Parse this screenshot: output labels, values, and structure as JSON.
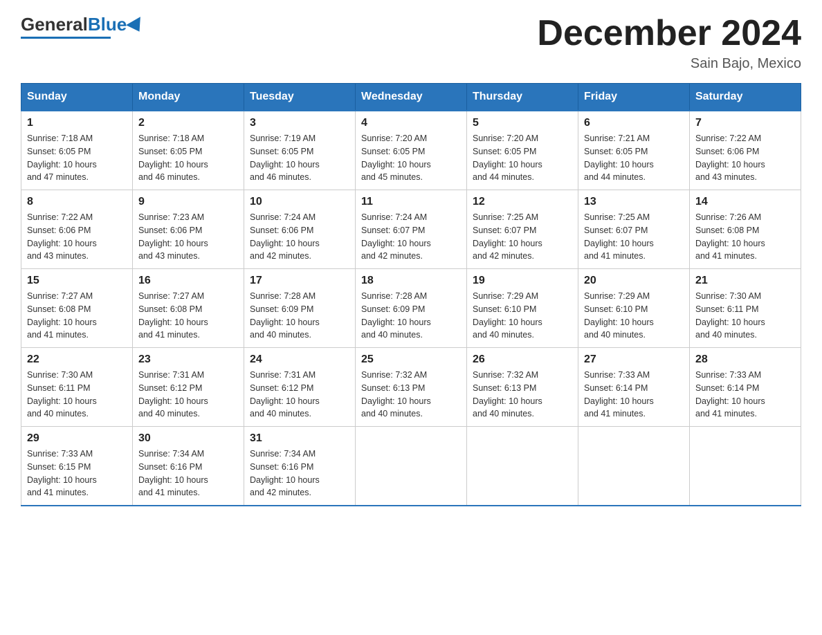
{
  "header": {
    "logo": {
      "general": "General",
      "blue": "Blue"
    },
    "title": "December 2024",
    "location": "Sain Bajo, Mexico"
  },
  "days_of_week": [
    "Sunday",
    "Monday",
    "Tuesday",
    "Wednesday",
    "Thursday",
    "Friday",
    "Saturday"
  ],
  "weeks": [
    [
      {
        "day": "1",
        "sunrise": "7:18 AM",
        "sunset": "6:05 PM",
        "daylight": "10 hours and 47 minutes."
      },
      {
        "day": "2",
        "sunrise": "7:18 AM",
        "sunset": "6:05 PM",
        "daylight": "10 hours and 46 minutes."
      },
      {
        "day": "3",
        "sunrise": "7:19 AM",
        "sunset": "6:05 PM",
        "daylight": "10 hours and 46 minutes."
      },
      {
        "day": "4",
        "sunrise": "7:20 AM",
        "sunset": "6:05 PM",
        "daylight": "10 hours and 45 minutes."
      },
      {
        "day": "5",
        "sunrise": "7:20 AM",
        "sunset": "6:05 PM",
        "daylight": "10 hours and 44 minutes."
      },
      {
        "day": "6",
        "sunrise": "7:21 AM",
        "sunset": "6:05 PM",
        "daylight": "10 hours and 44 minutes."
      },
      {
        "day": "7",
        "sunrise": "7:22 AM",
        "sunset": "6:06 PM",
        "daylight": "10 hours and 43 minutes."
      }
    ],
    [
      {
        "day": "8",
        "sunrise": "7:22 AM",
        "sunset": "6:06 PM",
        "daylight": "10 hours and 43 minutes."
      },
      {
        "day": "9",
        "sunrise": "7:23 AM",
        "sunset": "6:06 PM",
        "daylight": "10 hours and 43 minutes."
      },
      {
        "day": "10",
        "sunrise": "7:24 AM",
        "sunset": "6:06 PM",
        "daylight": "10 hours and 42 minutes."
      },
      {
        "day": "11",
        "sunrise": "7:24 AM",
        "sunset": "6:07 PM",
        "daylight": "10 hours and 42 minutes."
      },
      {
        "day": "12",
        "sunrise": "7:25 AM",
        "sunset": "6:07 PM",
        "daylight": "10 hours and 42 minutes."
      },
      {
        "day": "13",
        "sunrise": "7:25 AM",
        "sunset": "6:07 PM",
        "daylight": "10 hours and 41 minutes."
      },
      {
        "day": "14",
        "sunrise": "7:26 AM",
        "sunset": "6:08 PM",
        "daylight": "10 hours and 41 minutes."
      }
    ],
    [
      {
        "day": "15",
        "sunrise": "7:27 AM",
        "sunset": "6:08 PM",
        "daylight": "10 hours and 41 minutes."
      },
      {
        "day": "16",
        "sunrise": "7:27 AM",
        "sunset": "6:08 PM",
        "daylight": "10 hours and 41 minutes."
      },
      {
        "day": "17",
        "sunrise": "7:28 AM",
        "sunset": "6:09 PM",
        "daylight": "10 hours and 40 minutes."
      },
      {
        "day": "18",
        "sunrise": "7:28 AM",
        "sunset": "6:09 PM",
        "daylight": "10 hours and 40 minutes."
      },
      {
        "day": "19",
        "sunrise": "7:29 AM",
        "sunset": "6:10 PM",
        "daylight": "10 hours and 40 minutes."
      },
      {
        "day": "20",
        "sunrise": "7:29 AM",
        "sunset": "6:10 PM",
        "daylight": "10 hours and 40 minutes."
      },
      {
        "day": "21",
        "sunrise": "7:30 AM",
        "sunset": "6:11 PM",
        "daylight": "10 hours and 40 minutes."
      }
    ],
    [
      {
        "day": "22",
        "sunrise": "7:30 AM",
        "sunset": "6:11 PM",
        "daylight": "10 hours and 40 minutes."
      },
      {
        "day": "23",
        "sunrise": "7:31 AM",
        "sunset": "6:12 PM",
        "daylight": "10 hours and 40 minutes."
      },
      {
        "day": "24",
        "sunrise": "7:31 AM",
        "sunset": "6:12 PM",
        "daylight": "10 hours and 40 minutes."
      },
      {
        "day": "25",
        "sunrise": "7:32 AM",
        "sunset": "6:13 PM",
        "daylight": "10 hours and 40 minutes."
      },
      {
        "day": "26",
        "sunrise": "7:32 AM",
        "sunset": "6:13 PM",
        "daylight": "10 hours and 40 minutes."
      },
      {
        "day": "27",
        "sunrise": "7:33 AM",
        "sunset": "6:14 PM",
        "daylight": "10 hours and 41 minutes."
      },
      {
        "day": "28",
        "sunrise": "7:33 AM",
        "sunset": "6:14 PM",
        "daylight": "10 hours and 41 minutes."
      }
    ],
    [
      {
        "day": "29",
        "sunrise": "7:33 AM",
        "sunset": "6:15 PM",
        "daylight": "10 hours and 41 minutes."
      },
      {
        "day": "30",
        "sunrise": "7:34 AM",
        "sunset": "6:16 PM",
        "daylight": "10 hours and 41 minutes."
      },
      {
        "day": "31",
        "sunrise": "7:34 AM",
        "sunset": "6:16 PM",
        "daylight": "10 hours and 42 minutes."
      },
      null,
      null,
      null,
      null
    ]
  ],
  "labels": {
    "sunrise": "Sunrise:",
    "sunset": "Sunset:",
    "daylight": "Daylight:"
  }
}
